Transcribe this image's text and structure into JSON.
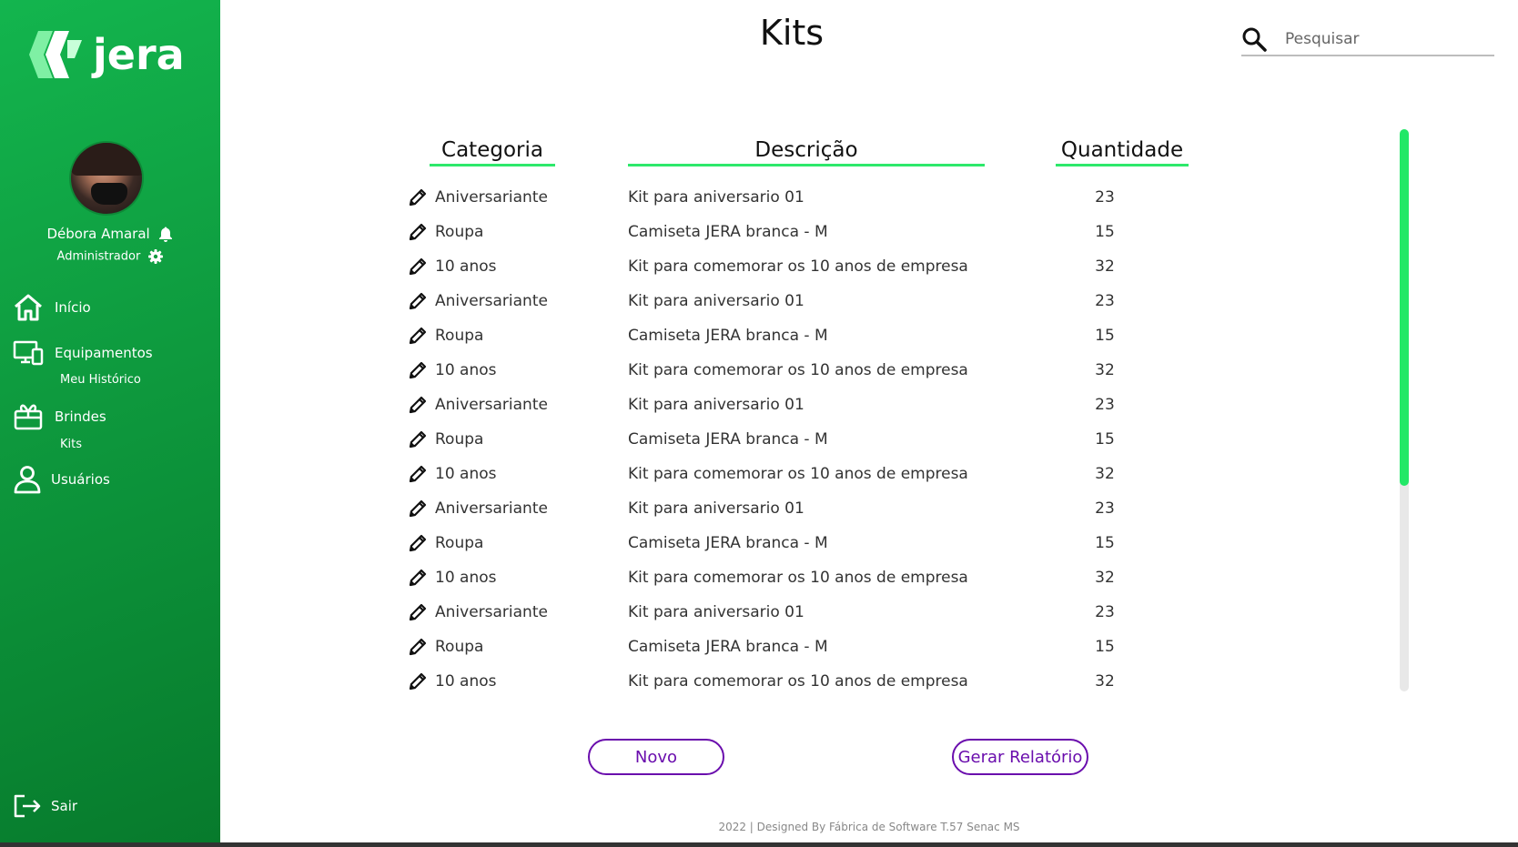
{
  "app": {
    "logo_text": "jera",
    "page_title": "Kits"
  },
  "colors": {
    "sidebar": "#0e9a3e",
    "accent_green": "#2de86b",
    "button_purple": "#6a0dad"
  },
  "user": {
    "name": "Débora Amaral",
    "role": "Administrador"
  },
  "nav": {
    "inicio": "Início",
    "equipamentos": "Equipamentos",
    "meu_historico": "Meu Histórico",
    "brindes": "Brindes",
    "kits": "Kits",
    "usuarios": "Usuários",
    "sair": "Sair"
  },
  "search": {
    "placeholder": "Pesquisar"
  },
  "table": {
    "headers": {
      "categoria": "Categoria",
      "descricao": "Descrição",
      "quantidade": "Quantidade"
    },
    "rows": [
      {
        "categoria": "Aniversariante",
        "descricao": "Kit para aniversario 01",
        "quantidade": "23"
      },
      {
        "categoria": "Roupa",
        "descricao": "Camiseta JERA branca - M",
        "quantidade": "15"
      },
      {
        "categoria": "10 anos",
        "descricao": "Kit para comemorar os 10 anos de empresa",
        "quantidade": "32"
      },
      {
        "categoria": "Aniversariante",
        "descricao": "Kit para aniversario 01",
        "quantidade": "23"
      },
      {
        "categoria": "Roupa",
        "descricao": "Camiseta JERA branca - M",
        "quantidade": "15"
      },
      {
        "categoria": "10 anos",
        "descricao": "Kit para comemorar os 10 anos de empresa",
        "quantidade": "32"
      },
      {
        "categoria": "Aniversariante",
        "descricao": "Kit para aniversario 01",
        "quantidade": "23"
      },
      {
        "categoria": "Roupa",
        "descricao": "Camiseta JERA branca - M",
        "quantidade": "15"
      },
      {
        "categoria": "10 anos",
        "descricao": "Kit para comemorar os 10 anos de empresa",
        "quantidade": "32"
      },
      {
        "categoria": "Aniversariante",
        "descricao": "Kit para aniversario 01",
        "quantidade": "23"
      },
      {
        "categoria": "Roupa",
        "descricao": "Camiseta JERA branca - M",
        "quantidade": "15"
      },
      {
        "categoria": "10 anos",
        "descricao": "Kit para comemorar os 10 anos de empresa",
        "quantidade": "32"
      },
      {
        "categoria": "Aniversariante",
        "descricao": "Kit para aniversario 01",
        "quantidade": "23"
      },
      {
        "categoria": "Roupa",
        "descricao": "Camiseta JERA branca - M",
        "quantidade": "15"
      },
      {
        "categoria": "10 anos",
        "descricao": "Kit para comemorar os 10 anos de empresa",
        "quantidade": "32"
      }
    ]
  },
  "buttons": {
    "novo": "Novo",
    "gerar_relatorio": "Gerar Relatório"
  },
  "footer": {
    "text": "2022 | Designed By Fábrica de Software T.57 Senac MS"
  }
}
